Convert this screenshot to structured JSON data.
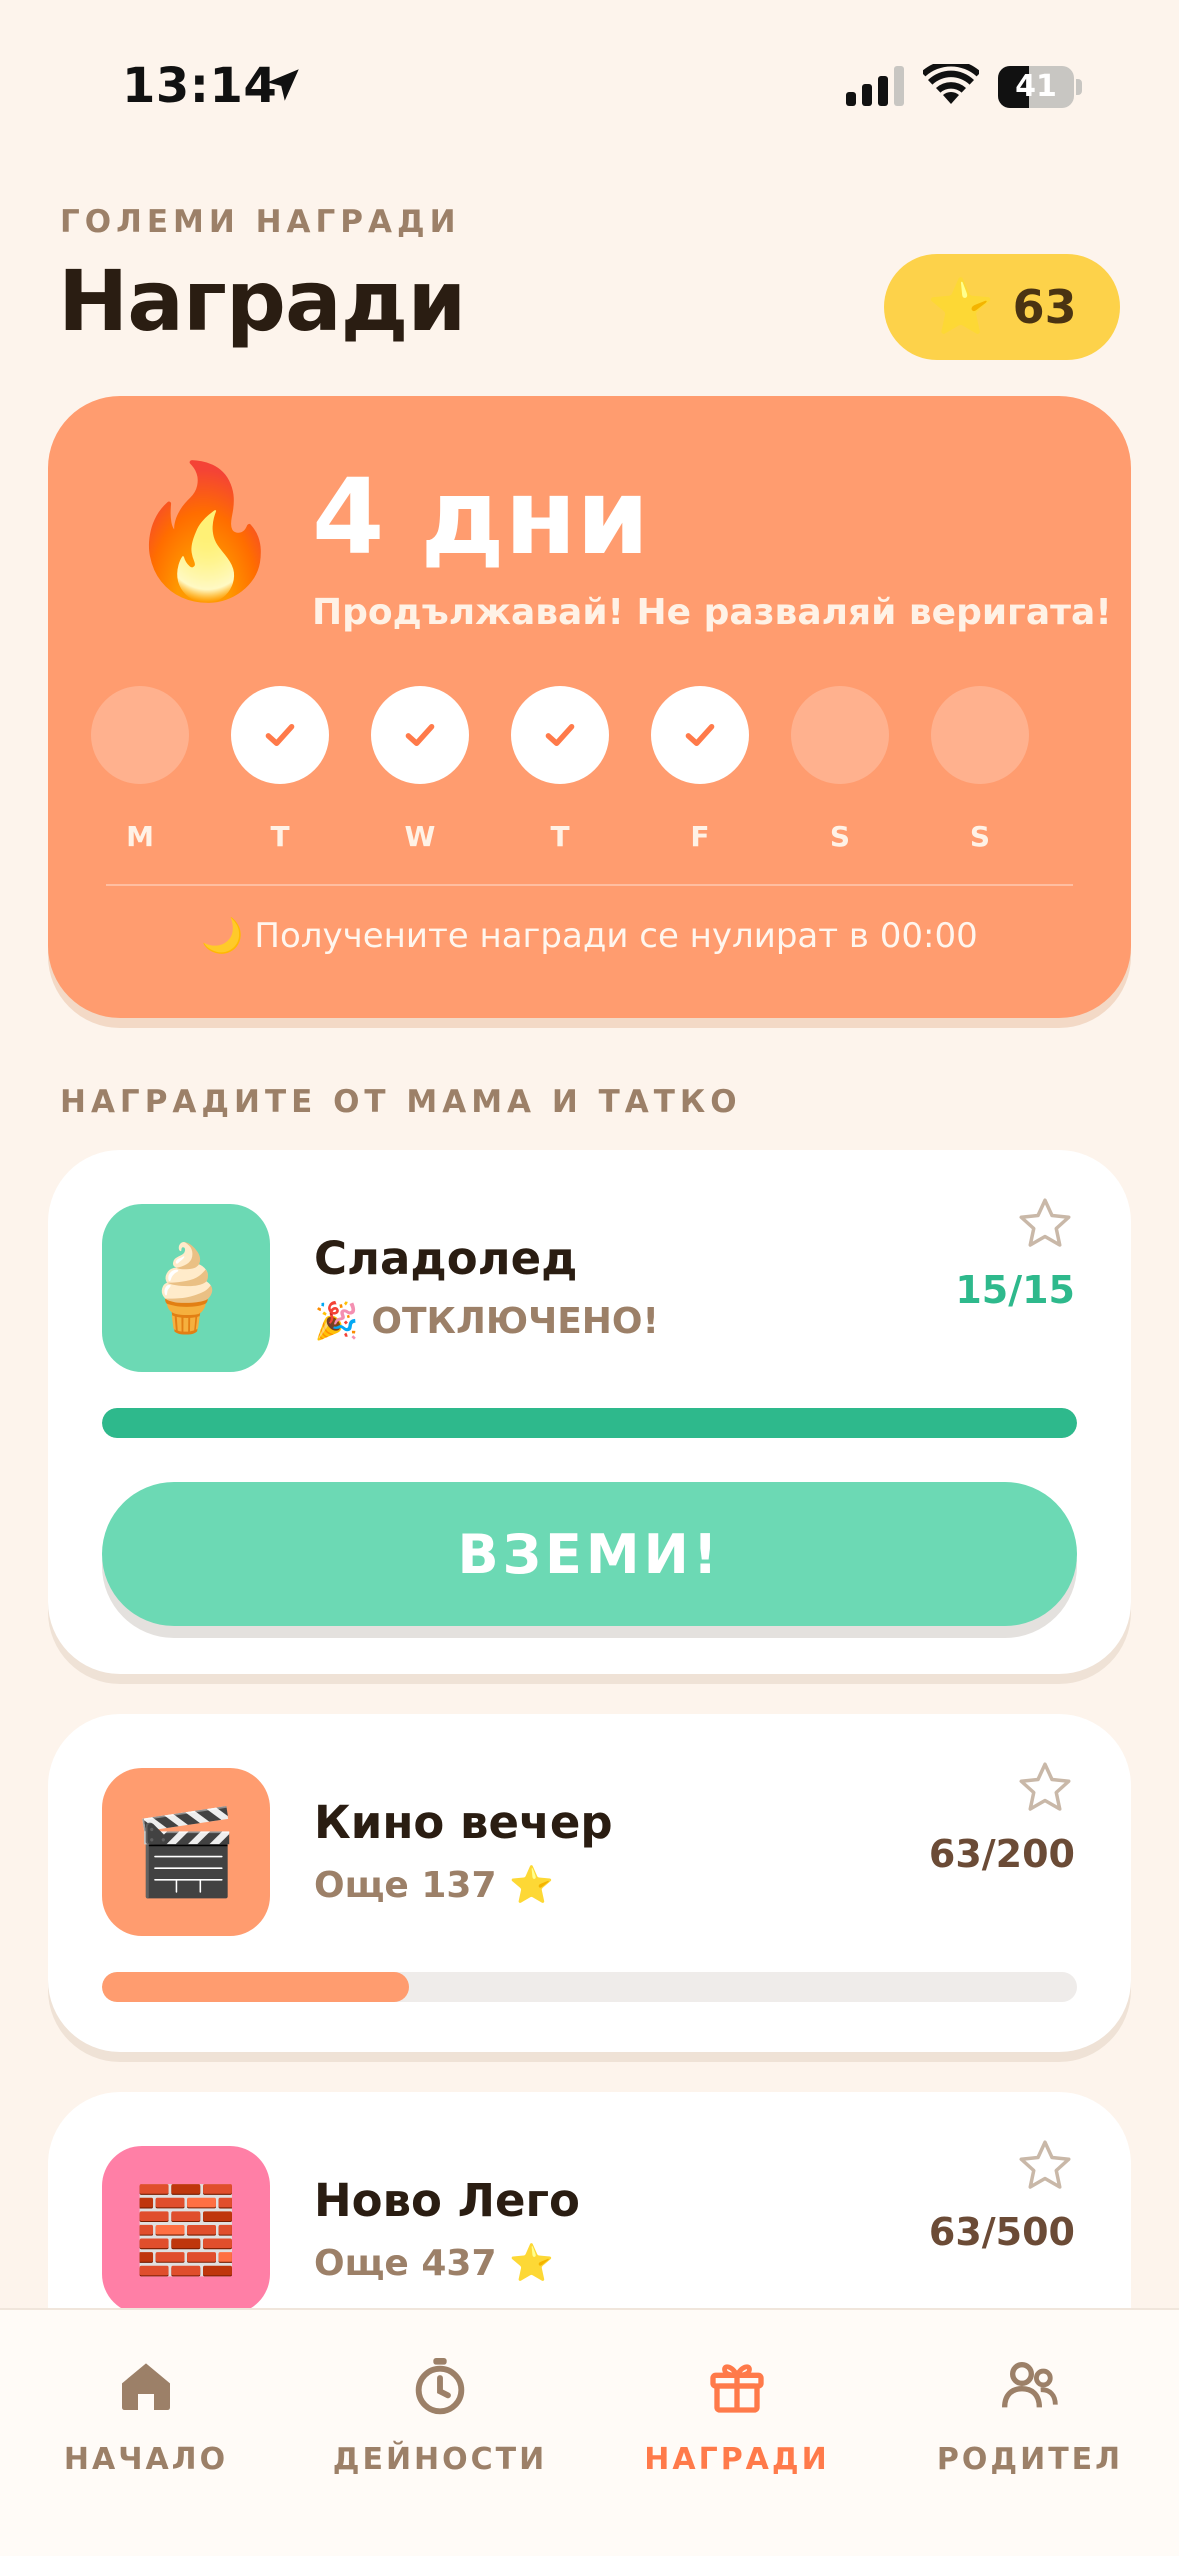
{
  "status_bar": {
    "time": "13:14",
    "battery": "41",
    "battery_level": 0.41
  },
  "header": {
    "eyebrow": "ГОЛЕМИ НАГРАДИ",
    "title": "Награди",
    "points_icon": "star-icon",
    "points": "63"
  },
  "streak": {
    "icon": "fire-icon",
    "days": "4 дни",
    "message": "Продължавай! Не разваляй веригата!",
    "week": [
      {
        "label": "M",
        "done": false
      },
      {
        "label": "T",
        "done": true
      },
      {
        "label": "W",
        "done": true
      },
      {
        "label": "T",
        "done": true
      },
      {
        "label": "F",
        "done": true
      },
      {
        "label": "S",
        "done": false
      },
      {
        "label": "S",
        "done": false
      }
    ],
    "reset_note": "🌙 Получените награди се нулират в 00:00"
  },
  "rewards_section": {
    "label": "НАГРАДИТЕ ОТ МАМА И ТАТКО"
  },
  "rewards": [
    {
      "icon": "ice-cream-icon",
      "emoji": "🍦",
      "name": "Сладолед",
      "subtitle": "🎉 ОТКЛЮЧЕНО!",
      "progress_text": "15/15",
      "current": 15,
      "target": 15,
      "icon_bg": "#6cd9b4",
      "bar_color": "#2eb98c",
      "text_color": "#2eb98c",
      "claim_label": "ВЗЕМИ!"
    },
    {
      "icon": "clapperboard-icon",
      "emoji": "🎬",
      "name": "Кино вечер",
      "subtitle": "Още 137 ⭐",
      "progress_text": "63/200",
      "current": 63,
      "target": 200,
      "icon_bg": "#ff9c6f",
      "bar_color": "#ff9c6f",
      "text_color": "#6b4b36"
    },
    {
      "icon": "brick-icon",
      "emoji": "🧱",
      "name": "Ново Лего",
      "subtitle": "Още 437 ⭐",
      "progress_text": "63/500",
      "current": 63,
      "target": 500,
      "icon_bg": "#ff7fa6",
      "bar_color": "#ff7fa6",
      "text_color": "#6b4b36"
    }
  ],
  "tabs": [
    {
      "label": "НАЧАЛО",
      "icon": "home-icon",
      "active": false
    },
    {
      "label": "ДЕЙНОСТИ",
      "icon": "stopwatch-icon",
      "active": false
    },
    {
      "label": "НАГРАДИ",
      "icon": "gift-icon",
      "active": true
    },
    {
      "label": "РОДИТЕЛ",
      "icon": "parents-icon",
      "active": false
    }
  ],
  "colors": {
    "background": "#fdf4ec",
    "accent": "#ff9c6f",
    "active_tab": "#ff7a4a",
    "points_pill": "#fdd24a"
  }
}
